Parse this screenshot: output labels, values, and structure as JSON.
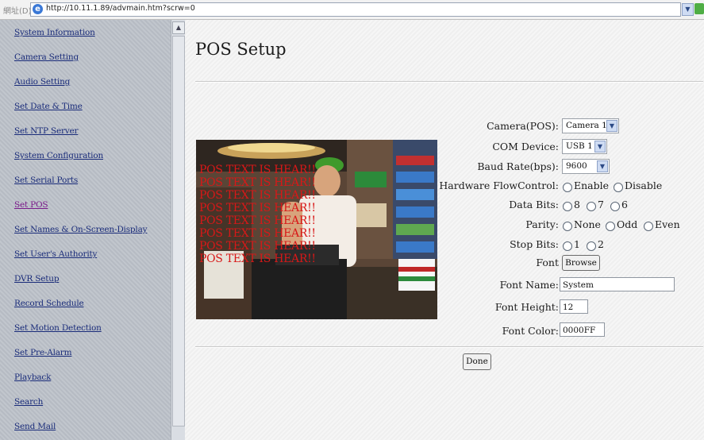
{
  "browser": {
    "address_label": "網址(D)",
    "url": "http://10.11.1.89/advmain.htm?scrw=0"
  },
  "sidebar": {
    "items": [
      {
        "label": "System Information"
      },
      {
        "label": "Camera Setting"
      },
      {
        "label": "Audio Setting"
      },
      {
        "label": "Set Date & Time"
      },
      {
        "label": "Set NTP Server"
      },
      {
        "label": "System Configuration"
      },
      {
        "label": "Set Serial Ports"
      },
      {
        "label": "Set POS",
        "active": true
      },
      {
        "label": "Set Names & On-Screen-Display"
      },
      {
        "label": "Set User's Authority"
      },
      {
        "label": "DVR Setup"
      },
      {
        "label": "Record Schedule"
      },
      {
        "label": "Set Motion Detection"
      },
      {
        "label": "Set Pre-Alarm"
      },
      {
        "label": "Playback"
      },
      {
        "label": "Search"
      },
      {
        "label": "Send Mail"
      }
    ]
  },
  "main": {
    "title": "POS Setup",
    "preview": {
      "overlay_lines": [
        "POS TEXT IS HEAR!!",
        "POS TEXT IS HEAR!!",
        "POS TEXT IS HEAR!!",
        "POS TEXT IS HEAR!!",
        "POS TEXT IS HEAR!!",
        "POS TEXT IS HEAR!!",
        "POS TEXT IS HEAR!!",
        "POS TEXT IS HEAR!!"
      ],
      "overlay_color": "#d81818"
    },
    "form": {
      "camera_label": "Camera(POS):",
      "camera_value": "Camera 1",
      "com_label": "COM Device:",
      "com_value": "USB 1",
      "baud_label": "Baud Rate(bps):",
      "baud_value": "9600",
      "flow_label": "Hardware FlowControl:",
      "flow_options": [
        "Enable",
        "Disable"
      ],
      "databits_label": "Data Bits:",
      "databits_options": [
        "8",
        "7",
        "6"
      ],
      "parity_label": "Parity:",
      "parity_options": [
        "None",
        "Odd",
        "Even"
      ],
      "stopbits_label": "Stop Bits:",
      "stopbits_options": [
        "1",
        "2"
      ],
      "font_label": "Font",
      "browse_label": "Browse",
      "font_name_label": "Font Name:",
      "font_name_value": "System",
      "font_height_label": "Font Height:",
      "font_height_value": "12",
      "font_color_label": "Font Color:",
      "font_color_value": "0000FF"
    },
    "done_label": "Done"
  }
}
